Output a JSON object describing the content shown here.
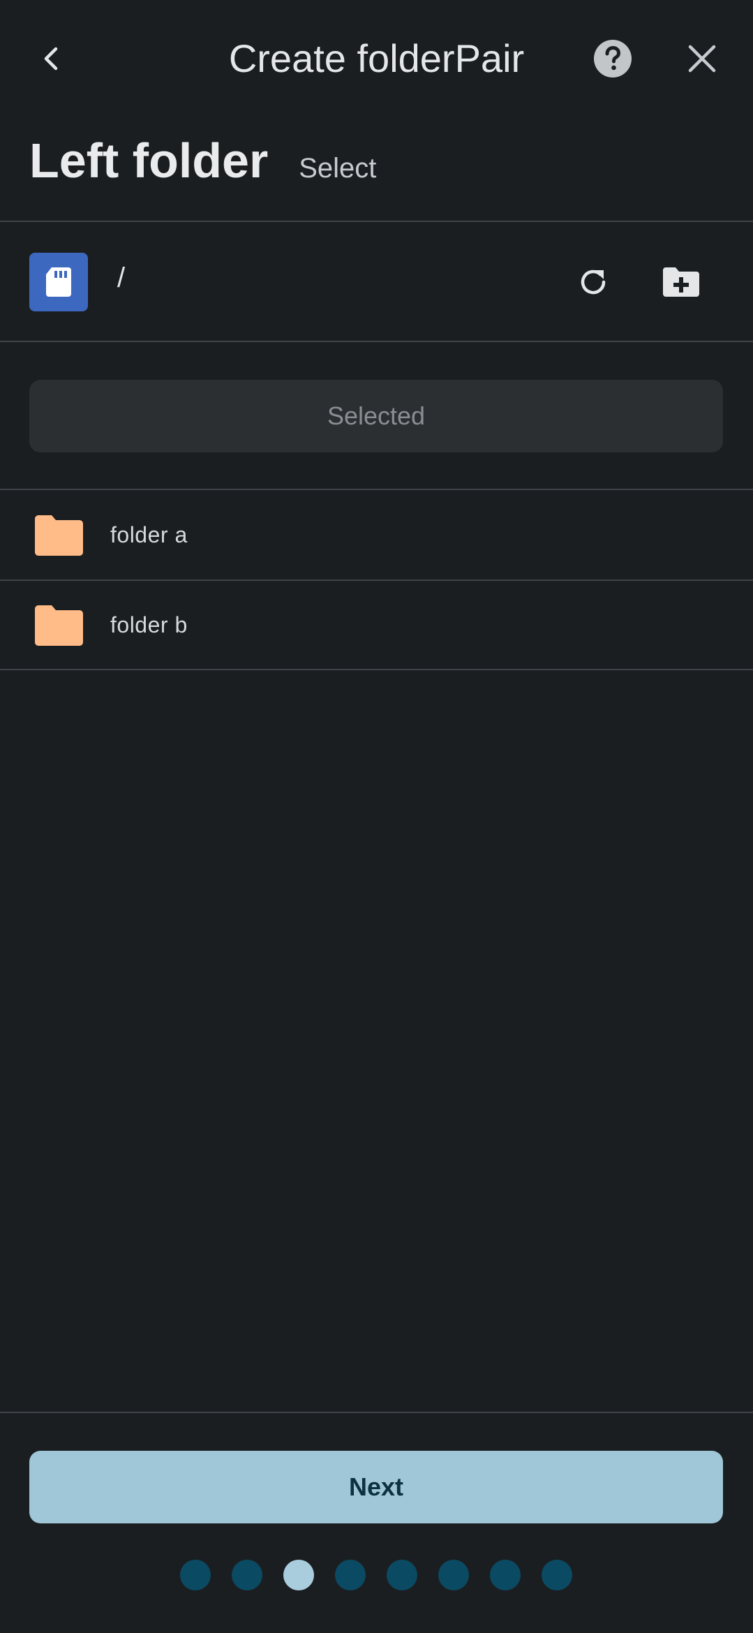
{
  "header": {
    "title": "Create folderPair",
    "back_icon": "chevron-left-icon",
    "help_icon": "help-circle-icon",
    "close_icon": "close-icon"
  },
  "section": {
    "title": "Left folder",
    "subtitle": "Select"
  },
  "path_bar": {
    "storage_icon": "sd-card-icon",
    "path": "/",
    "refresh_icon": "refresh-icon",
    "new_folder_icon": "create-folder-icon"
  },
  "selected_button": {
    "label": "Selected",
    "enabled": false
  },
  "folders": [
    {
      "name": "folder a",
      "icon": "folder-icon"
    },
    {
      "name": "folder b",
      "icon": "folder-icon"
    }
  ],
  "footer": {
    "next_label": "Next"
  },
  "pager": {
    "total": 8,
    "current_index": 2
  },
  "colors": {
    "background": "#1b1e21",
    "accent": "#9fc7d7",
    "folder": "#ffbb88",
    "storage_tile": "#3d68c0",
    "dot_inactive": "#0b4a63",
    "dot_active": "#a9cddd"
  }
}
